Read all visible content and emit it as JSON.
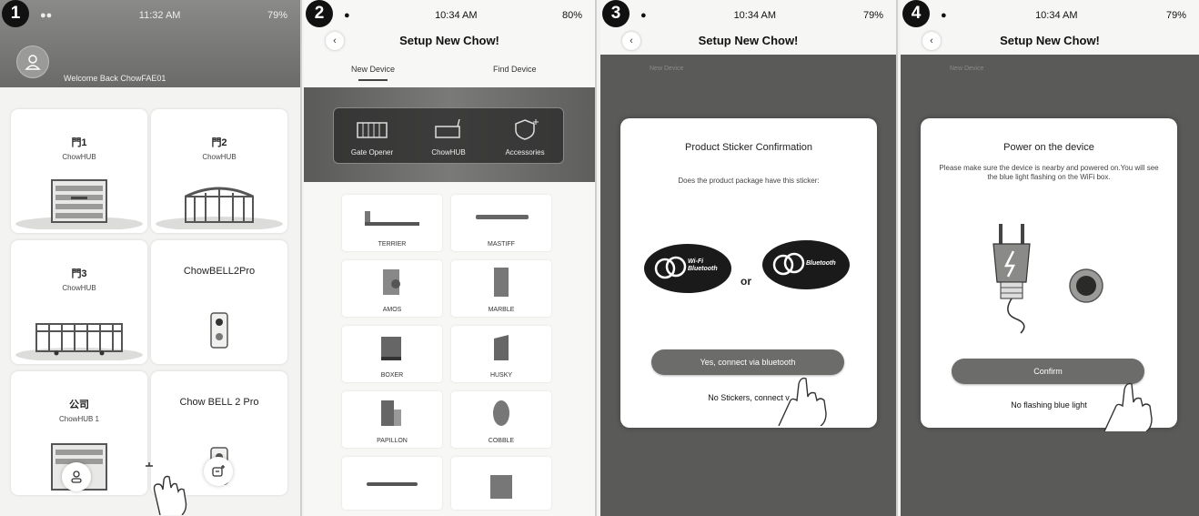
{
  "steps": [
    "1",
    "2",
    "3",
    "4"
  ],
  "screen1": {
    "status_time": "11:32 AM",
    "status_battery": "79%",
    "welcome": "Welcome Back ChowFAE01",
    "cards": [
      {
        "name": "門1",
        "sub": "ChowHUB"
      },
      {
        "name": "門2",
        "sub": "ChowHUB"
      },
      {
        "name": "門3",
        "sub": "ChowHUB"
      },
      {
        "name": "ChowBELL2Pro",
        "sub": ""
      },
      {
        "name": "公司",
        "sub": "ChowHUB 1"
      },
      {
        "name": "Chow BELL 2 Pro",
        "sub": ""
      }
    ]
  },
  "screen2": {
    "status_time": "10:34 AM",
    "status_battery": "80%",
    "title": "Setup New Chow!",
    "tabs": [
      "New Device",
      "Find Device"
    ],
    "categories": [
      "Gate Opener",
      "ChowHUB",
      "Accessories"
    ],
    "products": [
      "TERRIER",
      "MASTIFF",
      "AMOS",
      "MARBLE",
      "BOXER",
      "HUSKY",
      "PAPILLON",
      "COBBLE"
    ]
  },
  "screen3": {
    "status_time": "10:34 AM",
    "status_battery": "79%",
    "title": "Setup New Chow!",
    "tab_ghost": "New Device",
    "modal_title": "Product Sticker Confirmation",
    "modal_desc": "Does the product package have this sticker:",
    "sticker_left": "Wi-Fi Bluetooth",
    "sticker_or": "or",
    "sticker_right": "Bluetooth",
    "primary": "Yes, connect via bluetooth",
    "secondary": "No Stickers, connect v"
  },
  "screen4": {
    "status_time": "10:34 AM",
    "status_battery": "79%",
    "title": "Setup New Chow!",
    "tab_ghost": "New Device",
    "modal_title": "Power on the device",
    "modal_desc": "Please make sure the device is nearby and powered on.You will see the blue light flashing on the WiFi box.",
    "primary": "Confirm",
    "secondary": "No flashing blue light"
  }
}
